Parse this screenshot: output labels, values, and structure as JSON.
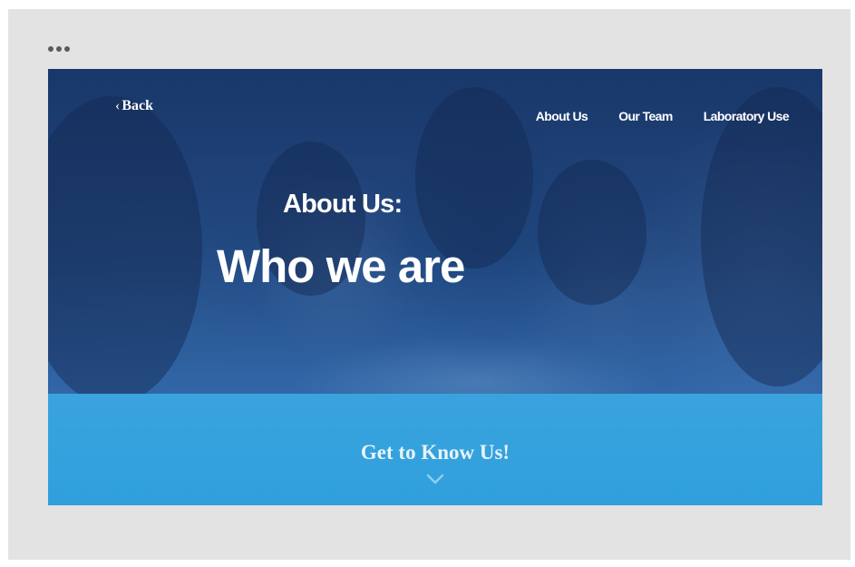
{
  "header": {
    "back_label": "Back",
    "nav_items": [
      "About Us",
      "Our Team",
      "Laboratory Use"
    ]
  },
  "hero": {
    "subtitle": "About Us:",
    "title": "Who we are"
  },
  "cta": {
    "label": "Get to Know Us!"
  },
  "colors": {
    "page_background": "#e3e3e3",
    "hero_overlay": "#1d3f78",
    "cta_band": "#35a2dd",
    "text": "#ffffff"
  },
  "icons": {
    "window_menu": "ellipsis-icon",
    "back": "chevron-left-icon",
    "scroll": "chevron-down-icon"
  }
}
